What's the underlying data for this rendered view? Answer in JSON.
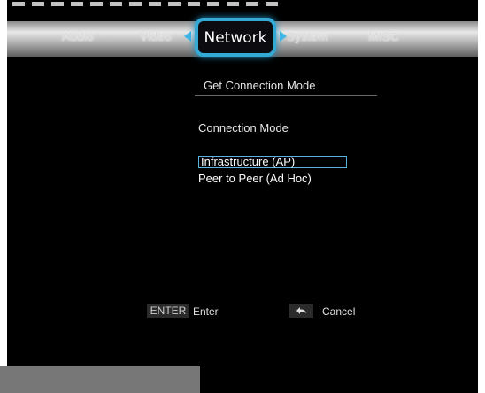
{
  "tabs": {
    "audio": "Audio",
    "video": "Video",
    "network": "Network",
    "system": "System",
    "misc": "MISC"
  },
  "page": {
    "title": "Get Connection Mode",
    "section_label": "Connection Mode",
    "options": [
      "Infrastructure (AP)",
      "Peer to Peer (Ad Hoc)"
    ]
  },
  "hints": {
    "enter_key": "ENTER",
    "enter_label": "Enter",
    "cancel_label": "Cancel"
  },
  "colors": {
    "accent": "#33a9d6",
    "background": "#000000"
  }
}
